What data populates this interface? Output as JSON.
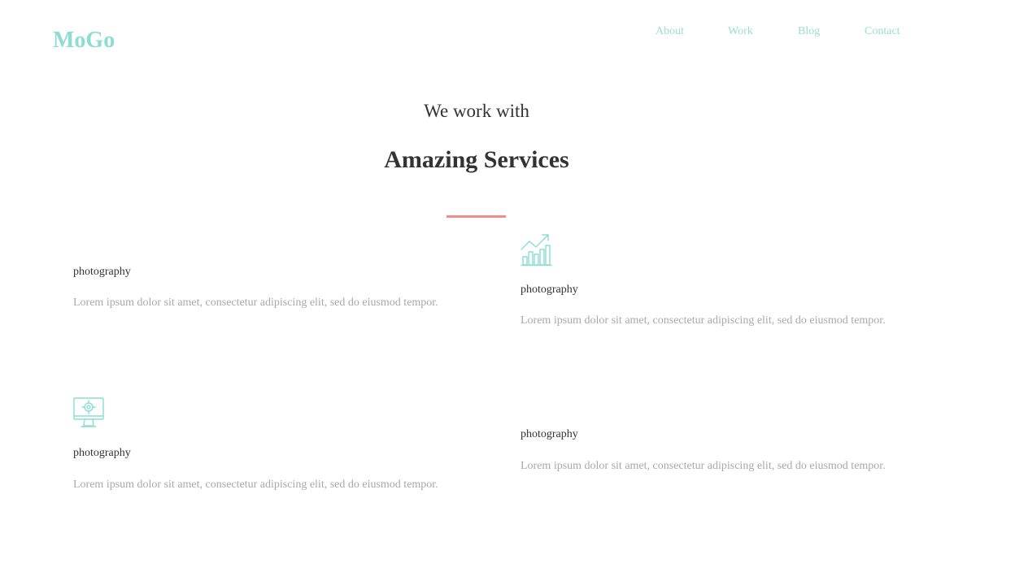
{
  "header": {
    "logo": "MoGo",
    "nav": [
      "About",
      "Work",
      "Blog",
      "Contact"
    ]
  },
  "services": {
    "subtitle": "We work with",
    "title": "Amazing Services",
    "items": [
      {
        "heading": "photography",
        "text": "Lorem ipsum dolor sit amet, consectetur adipiscing elit, sed do eiusmod tempor."
      },
      {
        "icon": "bar-chart-growth-icon",
        "heading": "photography",
        "text": "Lorem ipsum dolor sit amet, consectetur adipiscing elit, sed do eiusmod tempor."
      },
      {
        "icon": "monitor-gear-icon",
        "heading": "photography",
        "text": "Lorem ipsum dolor sit amet, consectetur adipiscing elit, sed do eiusmod tempor."
      },
      {
        "heading": "photography",
        "text": "Lorem ipsum dolor sit amet, consectetur adipiscing elit, sed do eiusmod tempor."
      }
    ]
  },
  "colors": {
    "accent": "#8fdcd2",
    "divider": "#f28b8b",
    "heading_text": "#333333",
    "body_text": "#a8a8a8"
  }
}
